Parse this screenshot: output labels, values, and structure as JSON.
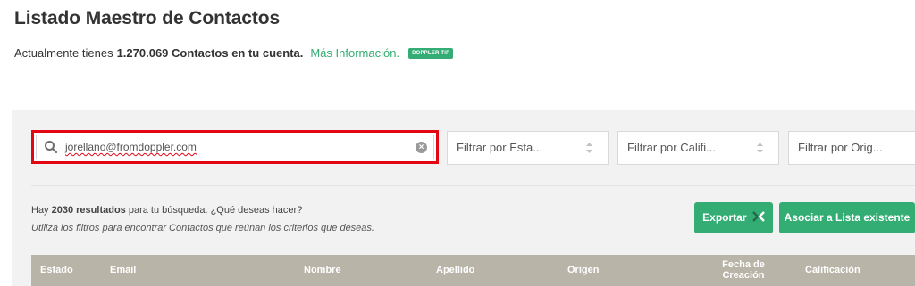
{
  "header": {
    "title": "Listado Maestro de Contactos",
    "account_prefix": "Actualmente tienes",
    "account_count": "1.270.069 Contactos en tu cuenta.",
    "more_info": "Más Información.",
    "tip_badge": "DOPPLER TIP"
  },
  "search": {
    "value": "jorellano@fromdoppler.com",
    "icon": "search-icon",
    "clear_icon": "close-circle-icon"
  },
  "filters": {
    "estado": "Filtrar por Esta...",
    "calificacion": "Filtrar por Califi...",
    "origen": "Filtrar por Orig..."
  },
  "results": {
    "prefix": "Hay",
    "count": "2030 resultados",
    "suffix": "para tu búsqueda. ¿Qué deseas hacer?",
    "hint": "Utiliza los filtros para encontrar Contactos que reúnan los criterios que deseas."
  },
  "actions": {
    "export_label": "Exportar",
    "associate_label": "Asociar a Lista existente"
  },
  "table": {
    "columns": [
      "Estado",
      "Email",
      "Nombre",
      "Apellido",
      "Origen",
      "Fecha de",
      "Creación",
      "Calificación"
    ]
  },
  "colors": {
    "accent_green": "#33ad73",
    "highlight_red": "#e30613",
    "table_header": "#b9b4a8"
  }
}
